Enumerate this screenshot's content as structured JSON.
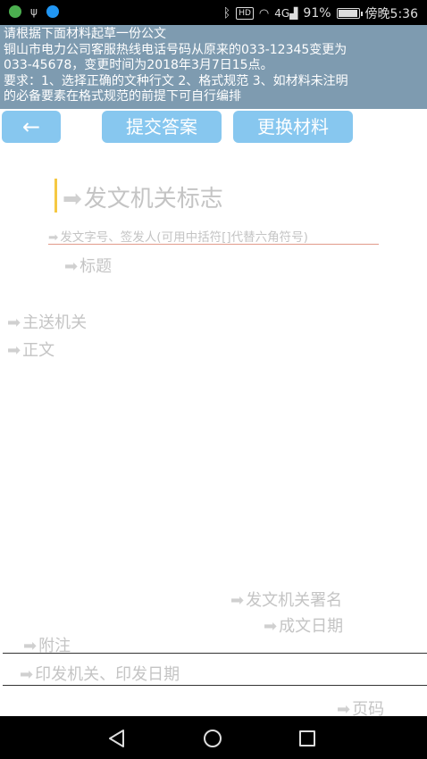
{
  "status_bar": {
    "hd_label": "HD",
    "signal_label": "4G",
    "battery_percent": "91%",
    "battery_level": 0.91,
    "time": "傍晚5:36",
    "icons": [
      "app-green-icon",
      "usb-icon",
      "app-blue-icon",
      "bluetooth-icon",
      "wifi-icon",
      "signal-icon",
      "battery-icon"
    ]
  },
  "instructions": {
    "line1": "请根据下面材料起草一份公文",
    "line2": "铜山市电力公司客服热线电话号码从原来的033-12345变更为",
    "line3": "033-45678，变更时间为2018年3月7日15点。",
    "line4": "要求：1、选择正确的文种行文 2、格式规范 3、如材料未注明",
    "line5": "的必备要素在格式规范的前提下可自行编排"
  },
  "toolbar": {
    "back_icon": "←",
    "submit_label": "提交答案",
    "change_label": "更换材料"
  },
  "form": {
    "arrow": "➡",
    "agency_mark": "发文机关标志",
    "doc_number": "发文字号、签发人(可用中括符[]代替六角符号)",
    "title": "标题",
    "recipient": "主送机关",
    "body": "正文",
    "signature": "发文机关署名",
    "date": "成文日期",
    "note": "附注",
    "issuer": "印发机关、印发日期",
    "page_number": "页码"
  },
  "colors": {
    "instruction_bg": "#7e9bb0",
    "button_bg": "#87c7ef",
    "cursor": "#f5c842",
    "placeholder": "#c4c4c4"
  }
}
